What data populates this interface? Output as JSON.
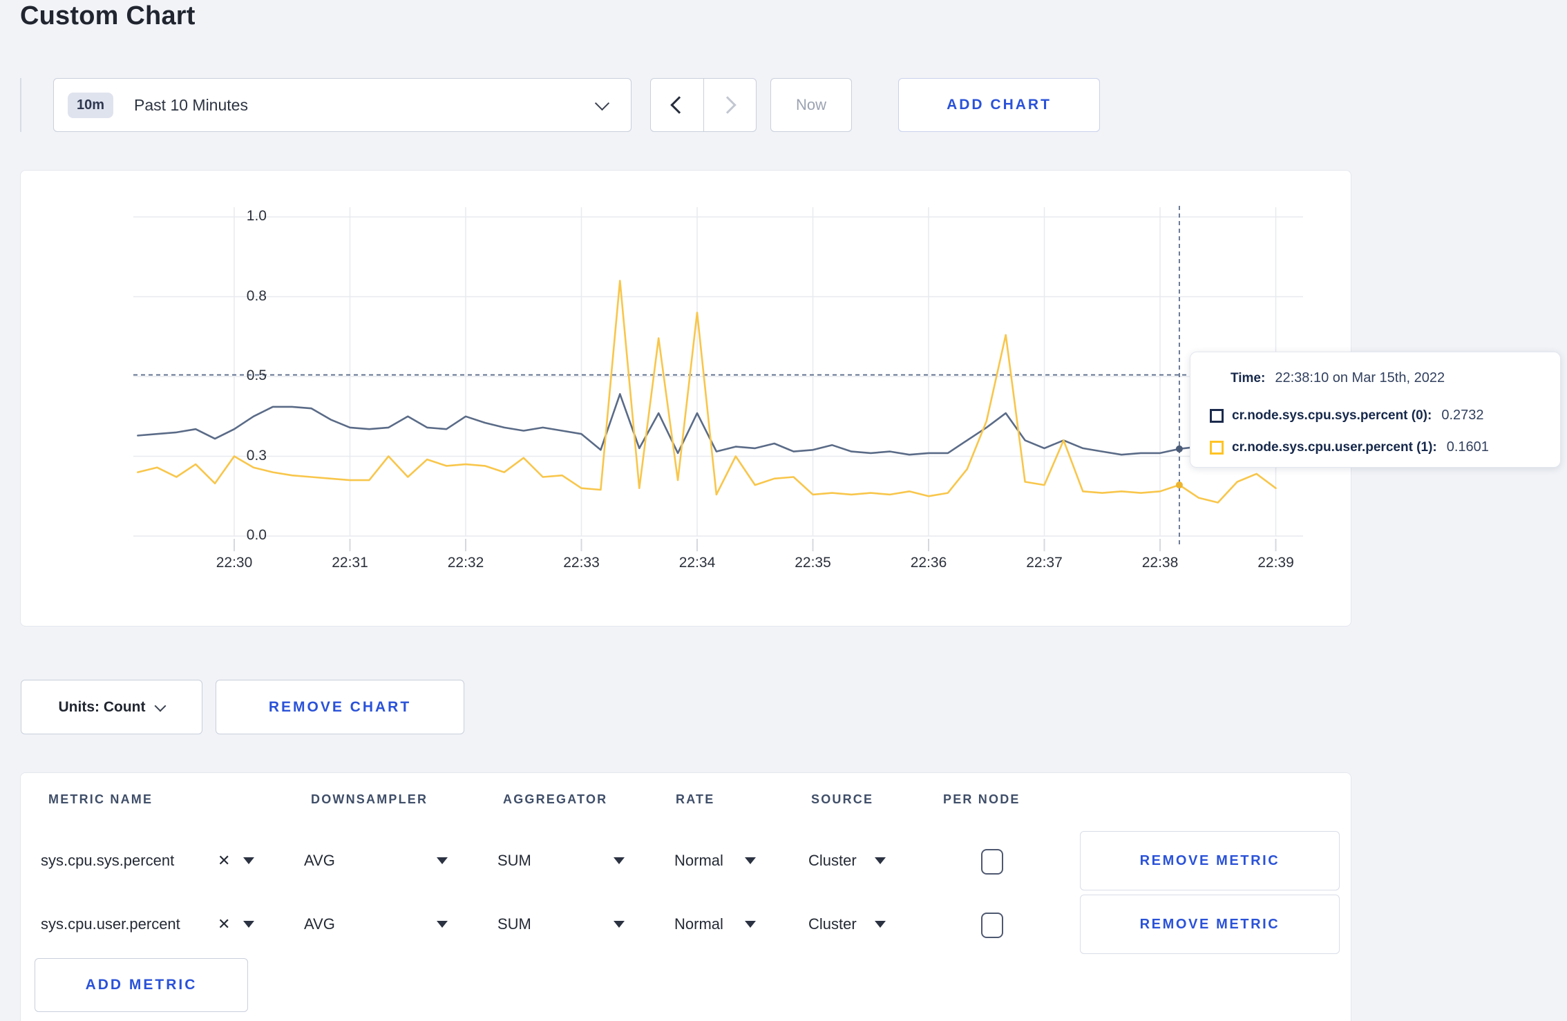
{
  "page": {
    "title": "Custom Chart",
    "accent_blue": "#2a52d8",
    "background": "#f1f3f7"
  },
  "toolbar": {
    "time_badge": "10m",
    "time_label": "Past 10 Minutes",
    "now_label": "Now",
    "add_chart_label": "ADD CHART"
  },
  "chart_data": {
    "type": "line",
    "title": "",
    "xlabel": "",
    "ylabel": "",
    "ylim": [
      0,
      1
    ],
    "grid": true,
    "start_time": "22:29:10",
    "interval_seconds": 10,
    "x_tick_labels": [
      "22:30",
      "22:31",
      "22:32",
      "22:33",
      "22:34",
      "22:35",
      "22:36",
      "22:37",
      "22:38",
      "22:39"
    ],
    "y_ticks": [
      {
        "label": "1.0",
        "pos": 1.0
      },
      {
        "label": "0.8",
        "pos": 0.75
      },
      {
        "label": "0.5",
        "pos": 0.5
      },
      {
        "label": "0.3",
        "pos": 0.25
      },
      {
        "label": "0.0",
        "pos": 0.0
      }
    ],
    "crosshair": {
      "index": 54,
      "time": "22:38:10",
      "y_value": 0.505
    },
    "series": [
      {
        "name": "cr.node.sys.cpu.sys.percent (0)",
        "color": "#5a6b87",
        "swatch": "#1b2b4d",
        "values": [
          0.315,
          0.32,
          0.325,
          0.335,
          0.305,
          0.335,
          0.375,
          0.405,
          0.405,
          0.4,
          0.365,
          0.34,
          0.335,
          0.34,
          0.375,
          0.34,
          0.335,
          0.375,
          0.355,
          0.34,
          0.33,
          0.34,
          0.33,
          0.32,
          0.27,
          0.445,
          0.275,
          0.385,
          0.26,
          0.385,
          0.265,
          0.28,
          0.275,
          0.29,
          0.265,
          0.27,
          0.285,
          0.265,
          0.26,
          0.265,
          0.255,
          0.26,
          0.26,
          0.3,
          0.34,
          0.385,
          0.3,
          0.275,
          0.3,
          0.275,
          0.265,
          0.255,
          0.26,
          0.26,
          0.2732,
          0.28,
          0.265,
          0.255,
          0.26,
          0.265
        ]
      },
      {
        "name": "cr.node.sys.cpu.user.percent (1)",
        "color": "#f8c64b",
        "swatch": "#ffc324",
        "values": [
          0.2,
          0.215,
          0.185,
          0.225,
          0.165,
          0.25,
          0.215,
          0.2,
          0.19,
          0.185,
          0.18,
          0.175,
          0.175,
          0.25,
          0.185,
          0.24,
          0.22,
          0.225,
          0.22,
          0.2,
          0.245,
          0.185,
          0.19,
          0.15,
          0.145,
          0.8,
          0.15,
          0.62,
          0.175,
          0.7,
          0.13,
          0.25,
          0.16,
          0.18,
          0.185,
          0.13,
          0.135,
          0.13,
          0.135,
          0.13,
          0.14,
          0.125,
          0.135,
          0.21,
          0.36,
          0.63,
          0.17,
          0.16,
          0.3,
          0.14,
          0.135,
          0.14,
          0.135,
          0.14,
          0.1601,
          0.12,
          0.105,
          0.17,
          0.195,
          0.15
        ]
      }
    ]
  },
  "tooltip": {
    "time_label": "Time:",
    "time_value": "22:38:10 on Mar 15th, 2022",
    "rows": [
      {
        "label": "cr.node.sys.cpu.sys.percent (0):",
        "value": "0.2732"
      },
      {
        "label": "cr.node.sys.cpu.user.percent (1):",
        "value": "0.1601"
      }
    ]
  },
  "chart_controls": {
    "units_label": "Units: Count",
    "remove_chart_label": "REMOVE CHART"
  },
  "metrics_table": {
    "headers": [
      "METRIC NAME",
      "DOWNSAMPLER",
      "AGGREGATOR",
      "RATE",
      "SOURCE",
      "PER NODE"
    ],
    "rows": [
      {
        "metric": "sys.cpu.sys.percent",
        "downsampler": "AVG",
        "aggregator": "SUM",
        "rate": "Normal",
        "source": "Cluster",
        "per_node_checked": false,
        "remove_label": "REMOVE METRIC"
      },
      {
        "metric": "sys.cpu.user.percent",
        "downsampler": "AVG",
        "aggregator": "SUM",
        "rate": "Normal",
        "source": "Cluster",
        "per_node_checked": false,
        "remove_label": "REMOVE METRIC"
      }
    ],
    "add_metric_label": "ADD METRIC"
  },
  "icons": {
    "clear": "✕"
  }
}
